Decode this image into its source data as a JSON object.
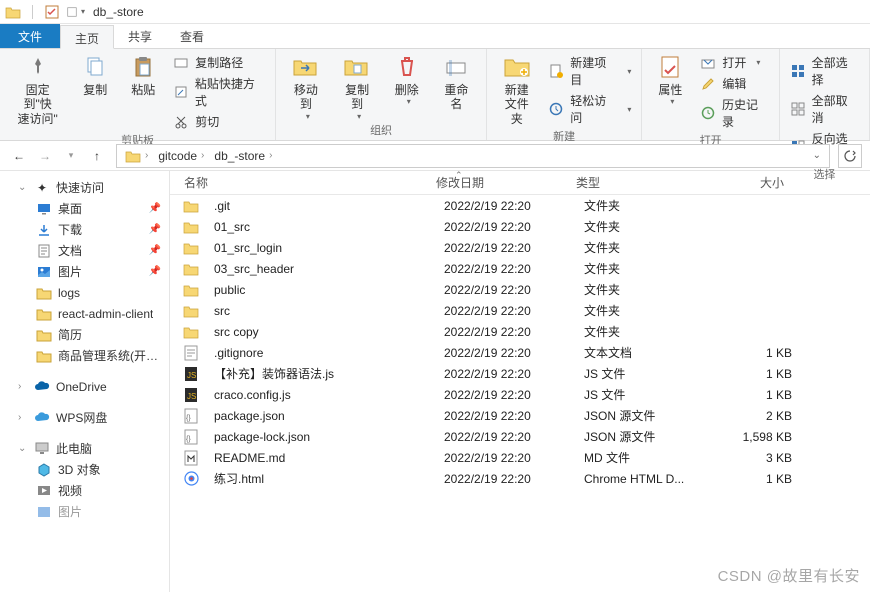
{
  "window": {
    "title": "db_-store"
  },
  "ribbon": {
    "tabs": {
      "file": "文件",
      "home": "主页",
      "share": "共享",
      "view": "查看"
    },
    "clipboard": {
      "pin": "固定到\"快\n速访问\"",
      "copy": "复制",
      "paste": "粘贴",
      "copy_path": "复制路径",
      "paste_shortcut": "粘贴快捷方式",
      "cut": "剪切",
      "label": "剪贴板"
    },
    "organize": {
      "move_to": "移动到",
      "copy_to": "复制到",
      "delete": "删除",
      "rename": "重命名",
      "label": "组织"
    },
    "new": {
      "new_folder": "新建\n文件夹",
      "new_item": "新建项目",
      "easy_access": "轻松访问",
      "label": "新建"
    },
    "open": {
      "properties": "属性",
      "open": "打开",
      "edit": "编辑",
      "history": "历史记录",
      "label": "打开"
    },
    "select": {
      "select_all": "全部选择",
      "select_none": "全部取消",
      "invert": "反向选择",
      "label": "选择"
    }
  },
  "breadcrumb": {
    "seg1": "gitcode",
    "seg2": "db_-store"
  },
  "nav": {
    "quick_access": "快速访问",
    "desktop": "桌面",
    "downloads": "下载",
    "documents": "文档",
    "pictures": "图片",
    "logs": "logs",
    "react_admin": "react-admin-client",
    "resume": "简历",
    "pms": "商品管理系统(开发)",
    "onedrive": "OneDrive",
    "wps": "WPS网盘",
    "this_pc": "此电脑",
    "obj3d": "3D 对象",
    "videos": "视频",
    "pictures2": "图片"
  },
  "columns": {
    "name": "名称",
    "date": "修改日期",
    "type": "类型",
    "size": "大小"
  },
  "files": [
    {
      "icon": "folder",
      "name": ".git",
      "date": "2022/2/19 22:20",
      "type": "文件夹",
      "size": ""
    },
    {
      "icon": "folder",
      "name": "01_src",
      "date": "2022/2/19 22:20",
      "type": "文件夹",
      "size": ""
    },
    {
      "icon": "folder",
      "name": "01_src_login",
      "date": "2022/2/19 22:20",
      "type": "文件夹",
      "size": ""
    },
    {
      "icon": "folder",
      "name": "03_src_header",
      "date": "2022/2/19 22:20",
      "type": "文件夹",
      "size": ""
    },
    {
      "icon": "folder",
      "name": "public",
      "date": "2022/2/19 22:20",
      "type": "文件夹",
      "size": ""
    },
    {
      "icon": "folder",
      "name": "src",
      "date": "2022/2/19 22:20",
      "type": "文件夹",
      "size": ""
    },
    {
      "icon": "folder",
      "name": "src copy",
      "date": "2022/2/19 22:20",
      "type": "文件夹",
      "size": ""
    },
    {
      "icon": "txt",
      "name": ".gitignore",
      "date": "2022/2/19 22:20",
      "type": "文本文档",
      "size": "1 KB"
    },
    {
      "icon": "js",
      "name": "【补充】装饰器语法.js",
      "date": "2022/2/19 22:20",
      "type": "JS 文件",
      "size": "1 KB"
    },
    {
      "icon": "js",
      "name": "craco.config.js",
      "date": "2022/2/19 22:20",
      "type": "JS 文件",
      "size": "1 KB"
    },
    {
      "icon": "json",
      "name": "package.json",
      "date": "2022/2/19 22:20",
      "type": "JSON 源文件",
      "size": "2 KB"
    },
    {
      "icon": "json",
      "name": "package-lock.json",
      "date": "2022/2/19 22:20",
      "type": "JSON 源文件",
      "size": "1,598 KB"
    },
    {
      "icon": "md",
      "name": "README.md",
      "date": "2022/2/19 22:20",
      "type": "MD 文件",
      "size": "3 KB"
    },
    {
      "icon": "html",
      "name": "练习.html",
      "date": "2022/2/19 22:20",
      "type": "Chrome HTML D...",
      "size": "1 KB"
    }
  ],
  "watermark": "CSDN @故里有长安"
}
